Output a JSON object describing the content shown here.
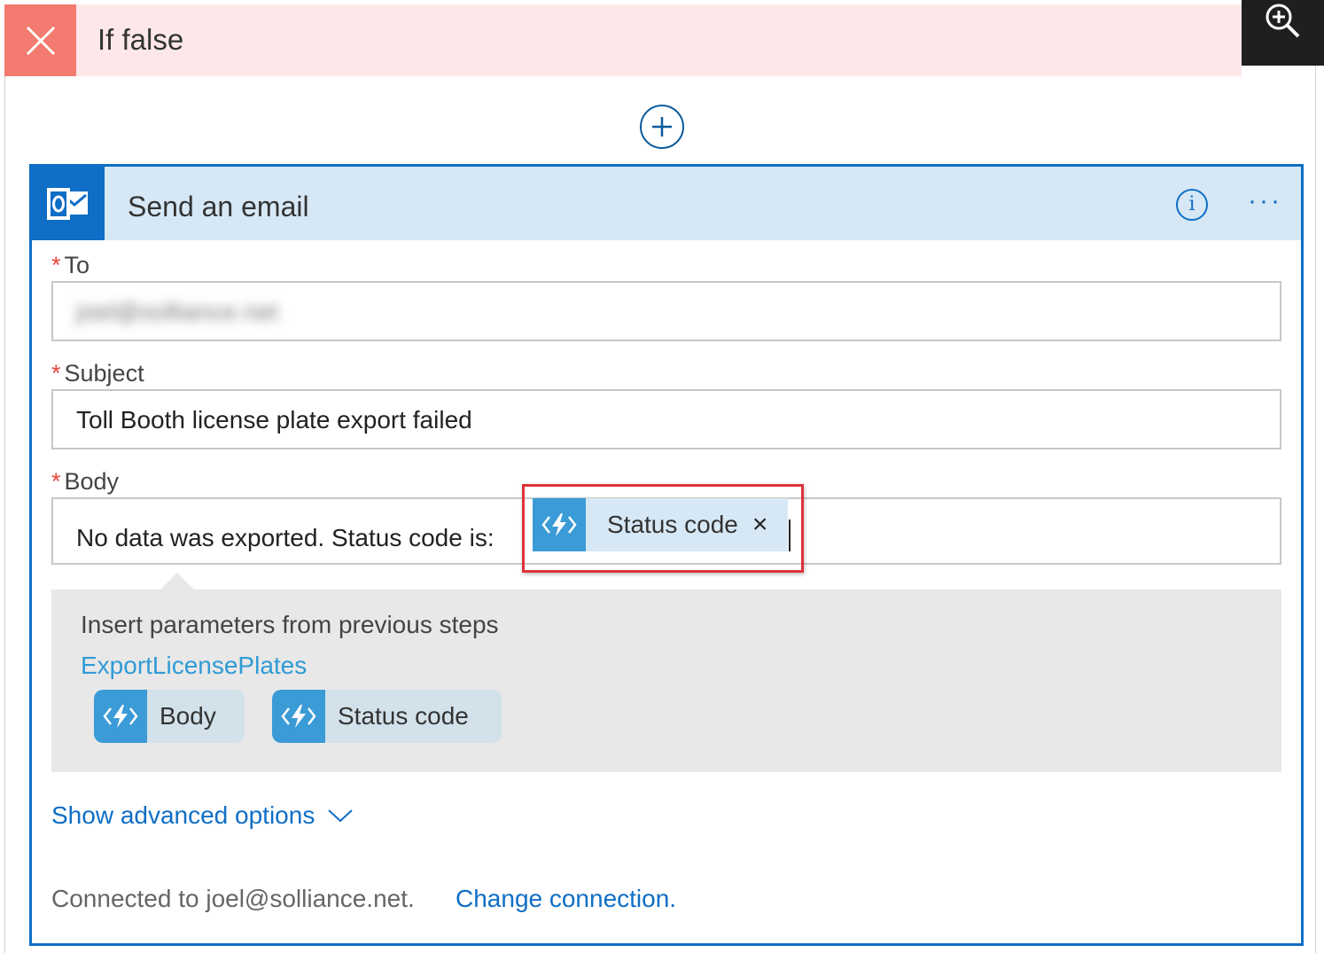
{
  "condition_branch": {
    "title": "If false",
    "status_color": "#f47b6f"
  },
  "toolbar": {
    "zoom_icon": "zoom-in-icon"
  },
  "add_step": {
    "icon": "plus-circle-icon"
  },
  "action_card": {
    "title": "Send an email",
    "connector_icon": "outlook-icon",
    "accent_color": "#0f6ec5",
    "info_glyph": "i",
    "more_glyph": "···",
    "fields": {
      "to": {
        "required_mark": "*",
        "label": "To",
        "value": "joel@solliance.net"
      },
      "subject": {
        "required_mark": "*",
        "label": "Subject",
        "value": "Toll Booth license plate export failed"
      },
      "body": {
        "required_mark": "*",
        "label": "Body",
        "value": "No data was exported. Status code is:",
        "token": {
          "label": "Status code",
          "remove_glyph": "×",
          "icon": "function-icon"
        }
      }
    },
    "dynamic_content": {
      "title": "Insert parameters from previous steps",
      "group": "ExportLicensePlates",
      "items": [
        {
          "label": "Body",
          "icon": "function-icon"
        },
        {
          "label": "Status code",
          "icon": "function-icon"
        }
      ]
    },
    "advanced_options": {
      "label": "Show advanced options",
      "icon": "chevron-down-icon"
    },
    "connection": {
      "text": "Connected to joel@solliance.net.",
      "change_link": "Change connection."
    }
  }
}
